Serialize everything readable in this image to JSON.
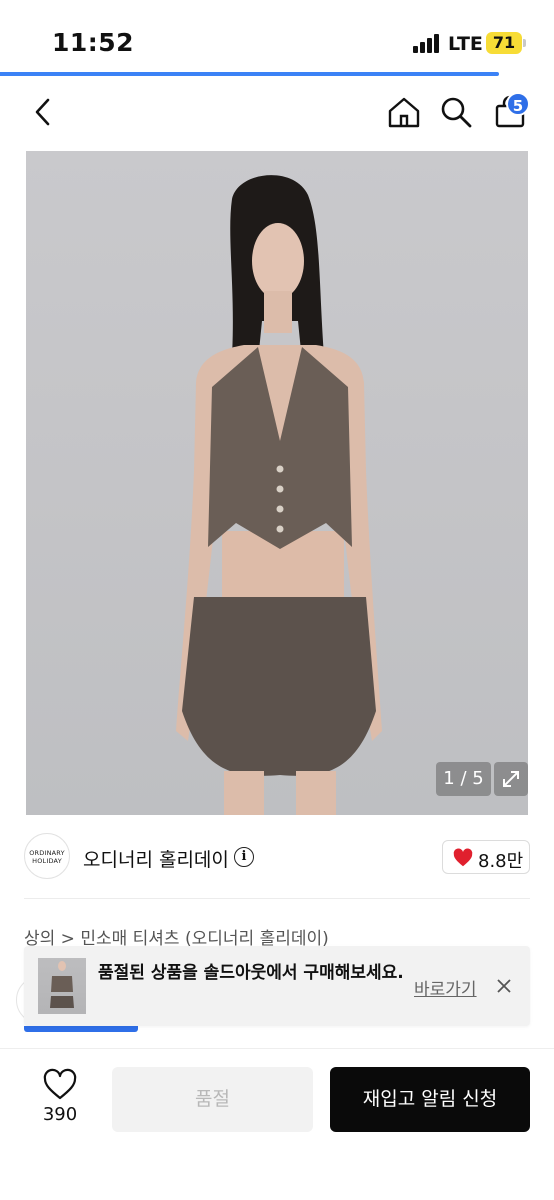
{
  "status_bar": {
    "time": "11:52",
    "network": "LTE",
    "battery": "71"
  },
  "page_load_progress": 0.9,
  "nav": {
    "back_icon": "chevron-left-icon",
    "home_icon": "home-icon",
    "search_icon": "search-icon",
    "cart_icon": "shopping-bag-icon",
    "cart_count": "5"
  },
  "product_image": {
    "counter": "1 / 5",
    "expand_icon": "expand-icon"
  },
  "brand": {
    "logo_text_line1": "ORDINARY",
    "logo_text_line2": "HOLIDAY",
    "name": "오디너리 홀리데이",
    "info_icon": "i",
    "like_count": "8.8만"
  },
  "breadcrumb": "상의 > 민소매 티셔츠 (오디너리 홀리데이)",
  "toast": {
    "message": "품절된 상품을 솔드아웃에서 구매해보세요.",
    "link": "바로가기",
    "close_icon": "close-icon"
  },
  "bottom_bar": {
    "wish_count": "390",
    "soldout_label": "품절",
    "restock_label": "재입고 알림 신청"
  },
  "colors": {
    "accent": "#2f6fe8",
    "battery": "#f7dc36",
    "heart": "#e0202e",
    "cta": "#0a0a0a"
  }
}
